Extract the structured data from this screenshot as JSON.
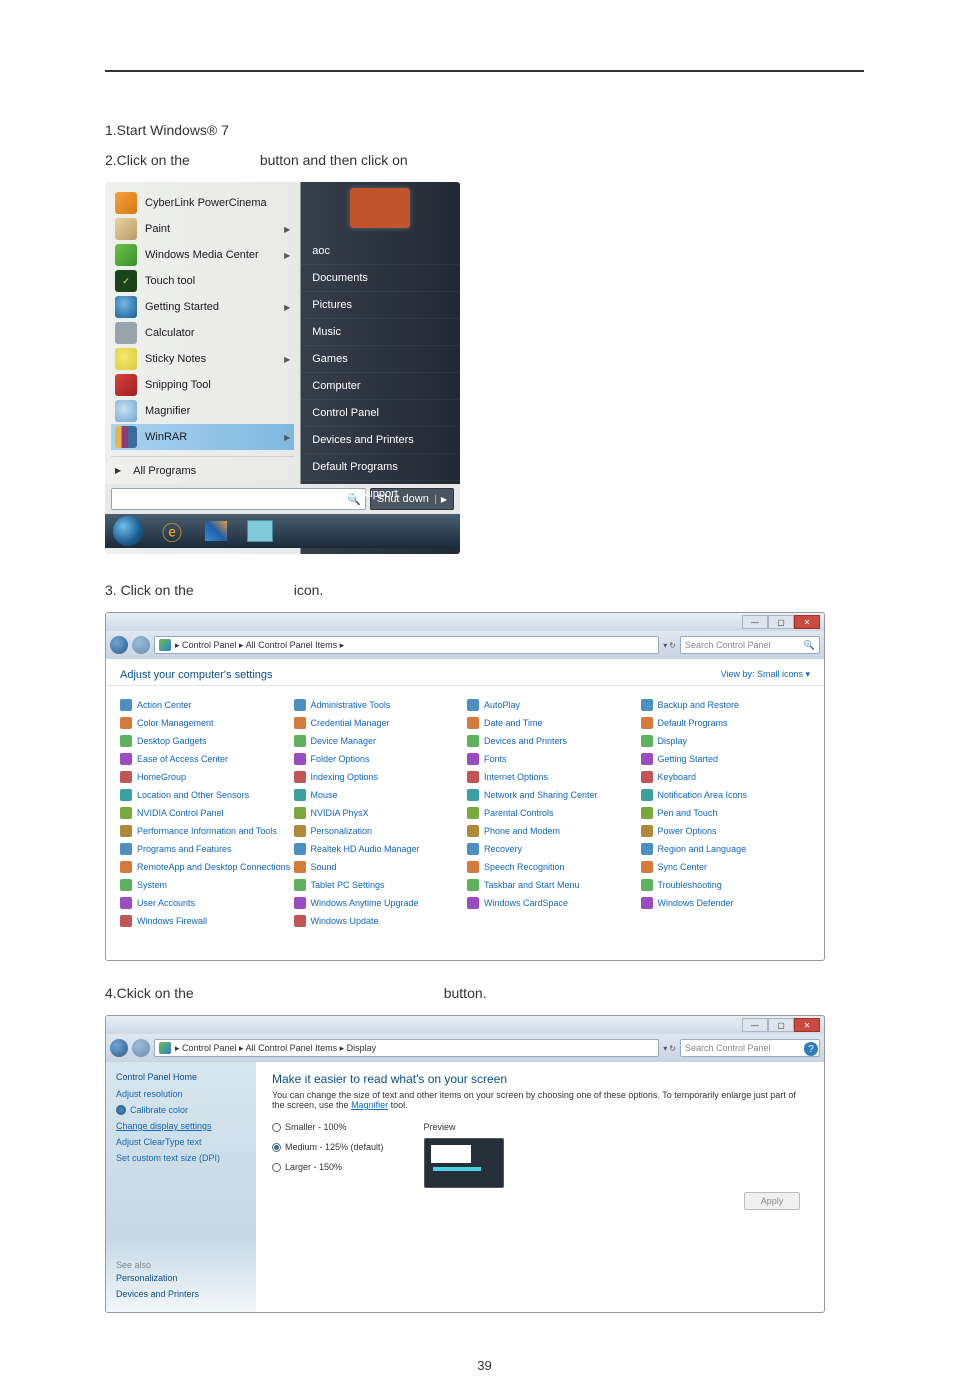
{
  "steps": {
    "s1": "1.Start Windows® 7",
    "s2a": "2.Click on the",
    "s2b": "button and then click on",
    "s3a": "3.  Click on the",
    "s3b": "icon.",
    "s4a": "4.Ckick on the",
    "s4b": "button."
  },
  "start_menu": {
    "left_items": [
      "CyberLink PowerCinema",
      "Paint",
      "Windows Media Center",
      "Touch tool",
      "Getting Started",
      "Calculator",
      "Sticky Notes",
      "Snipping Tool",
      "Magnifier",
      "WinRAR"
    ],
    "all_programs": "All Programs",
    "right_items": [
      "aoc",
      "Documents",
      "Pictures",
      "Music",
      "Games",
      "Computer",
      "Control Panel",
      "Devices and Printers",
      "Default Programs",
      "Help and Support"
    ],
    "shutdown": "Shut down"
  },
  "control_panel": {
    "breadcrumb": "▸ Control Panel ▸ All Control Panel Items ▸",
    "search_placeholder": "Search Control Panel",
    "heading": "Adjust your computer's settings",
    "view_by": "View by:   Small icons ▾",
    "columns": [
      [
        "Action Center",
        "Color Management",
        "Desktop Gadgets",
        "Ease of Access Center",
        "HomeGroup",
        "Location and Other Sensors",
        "NVIDIA Control Panel",
        "Performance Information and Tools",
        "Programs and Features",
        "RemoteApp and Desktop Connections",
        "System",
        "User Accounts",
        "Windows Firewall"
      ],
      [
        "Administrative Tools",
        "Credential Manager",
        "Device Manager",
        "Folder Options",
        "Indexing Options",
        "Mouse",
        "NVIDIA PhysX",
        "Personalization",
        "Realtek HD Audio Manager",
        "Sound",
        "Tablet PC Settings",
        "Windows Anytime Upgrade",
        "Windows Update"
      ],
      [
        "AutoPlay",
        "Date and Time",
        "Devices and Printers",
        "Fonts",
        "Internet Options",
        "Network and Sharing Center",
        "Parental Controls",
        "Phone and Modem",
        "Recovery",
        "Speech Recognition",
        "Taskbar and Start Menu",
        "Windows CardSpace"
      ],
      [
        "Backup and Restore",
        "Default Programs",
        "Display",
        "Getting Started",
        "Keyboard",
        "Notification Area Icons",
        "Pen and Touch",
        "Power Options",
        "Region and Language",
        "Sync Center",
        "Troubleshooting",
        "Windows Defender"
      ]
    ]
  },
  "display_panel": {
    "breadcrumb": "▸ Control Panel ▸ All Control Panel Items ▸ Display",
    "search_placeholder": "Search Control Panel",
    "side_header": "Control Panel Home",
    "side_links": [
      "Adjust resolution",
      "Calibrate color",
      "Change display settings",
      "Adjust ClearType text",
      "Set custom text size (DPI)"
    ],
    "see_also_heading": "See also",
    "see_also": [
      "Personalization",
      "Devices and Printers"
    ],
    "title": "Make it easier to read what's on your screen",
    "desc_a": "You can change the size of text and other items on your screen by choosing one of these options. To temporarily enlarge just part of the screen, use the ",
    "desc_link": "Magnifier",
    "desc_b": " tool.",
    "opts": [
      "Smaller - 100%",
      "Medium - 125% (default)",
      "Larger - 150%"
    ],
    "preview": "Preview",
    "apply": "Apply"
  },
  "page_number": "39"
}
